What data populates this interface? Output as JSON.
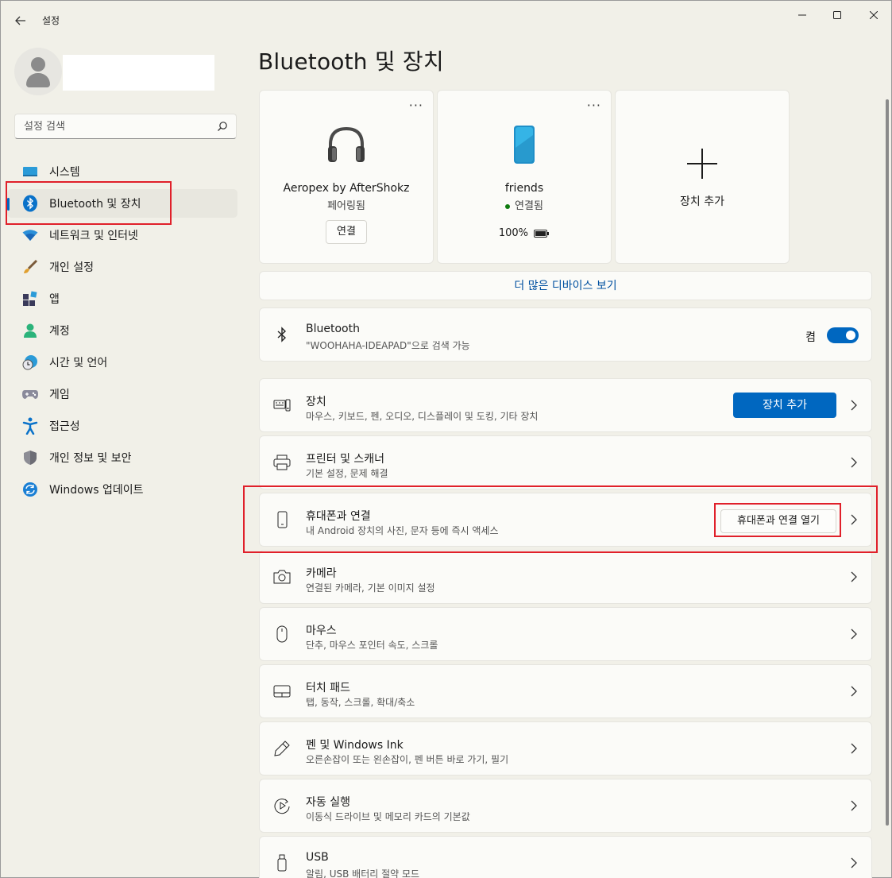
{
  "window": {
    "title": "설정",
    "controls": {
      "minimize": "minimize-icon",
      "maximize": "maximize-icon",
      "close": "close-icon"
    }
  },
  "sidebar": {
    "search_placeholder": "설정 검색",
    "items": [
      {
        "label": "시스템",
        "icon": "system-icon"
      },
      {
        "label": "Bluetooth 및 장치",
        "icon": "bluetooth-icon",
        "active": true
      },
      {
        "label": "네트워크 및 인터넷",
        "icon": "wifi-icon"
      },
      {
        "label": "개인 설정",
        "icon": "brush-icon"
      },
      {
        "label": "앱",
        "icon": "apps-icon"
      },
      {
        "label": "계정",
        "icon": "account-icon"
      },
      {
        "label": "시간 및 언어",
        "icon": "time-language-icon"
      },
      {
        "label": "게임",
        "icon": "gamepad-icon"
      },
      {
        "label": "접근성",
        "icon": "accessibility-icon"
      },
      {
        "label": "개인 정보 및 보안",
        "icon": "shield-icon"
      },
      {
        "label": "Windows 업데이트",
        "icon": "update-icon"
      }
    ]
  },
  "main": {
    "page_title": "Bluetooth 및 장치",
    "devices": [
      {
        "name": "Aeropex by AfterShokz",
        "status": "페어링됨",
        "action": "연결",
        "icon": "headphones-icon"
      },
      {
        "name": "friends",
        "status": "연결됨",
        "battery": "100%",
        "icon": "phone-icon"
      }
    ],
    "add_device_card": {
      "label": "장치 추가"
    },
    "more_devices": "더 많은 디바이스 보기",
    "bluetooth": {
      "title": "Bluetooth",
      "subtitle": "\"WOOHAHA-IDEAPAD\"으로 검색 가능",
      "toggle_label": "켬",
      "enabled": true
    },
    "settings_rows": [
      {
        "title": "장치",
        "subtitle": "마우스, 키보드, 펜, 오디오, 디스플레이 및 도킹, 기타 장치",
        "button": "장치 추가",
        "icon": "devices-icon"
      },
      {
        "title": "프린터 및 스캐너",
        "subtitle": "기본 설정, 문제 해결",
        "icon": "printer-icon"
      },
      {
        "title": "휴대폰과 연결",
        "subtitle": "내 Android 장치의 사진, 문자 등에 즉시 액세스",
        "button": "휴대폰과 연결 열기",
        "icon": "mobile-icon"
      },
      {
        "title": "카메라",
        "subtitle": "연결된 카메라, 기본 이미지 설정",
        "icon": "camera-icon"
      },
      {
        "title": "마우스",
        "subtitle": "단추, 마우스 포인터 속도, 스크롤",
        "icon": "mouse-icon"
      },
      {
        "title": "터치 패드",
        "subtitle": "탭, 동작, 스크롤, 확대/축소",
        "icon": "touchpad-icon"
      },
      {
        "title": "펜 및 Windows Ink",
        "subtitle": "오른손잡이 또는 왼손잡이, 펜 버튼 바로 가기, 필기",
        "icon": "pen-icon"
      },
      {
        "title": "자동 실행",
        "subtitle": "이동식 드라이브 및 메모리 카드의 기본값",
        "icon": "autoplay-icon"
      },
      {
        "title": "USB",
        "subtitle": "알림, USB 배터리 절약 모드",
        "icon": "usb-icon"
      }
    ]
  },
  "colors": {
    "accent": "#0067c0",
    "highlight": "#e0202a",
    "background": "#f1f0e8",
    "card": "#fbfbf8"
  }
}
